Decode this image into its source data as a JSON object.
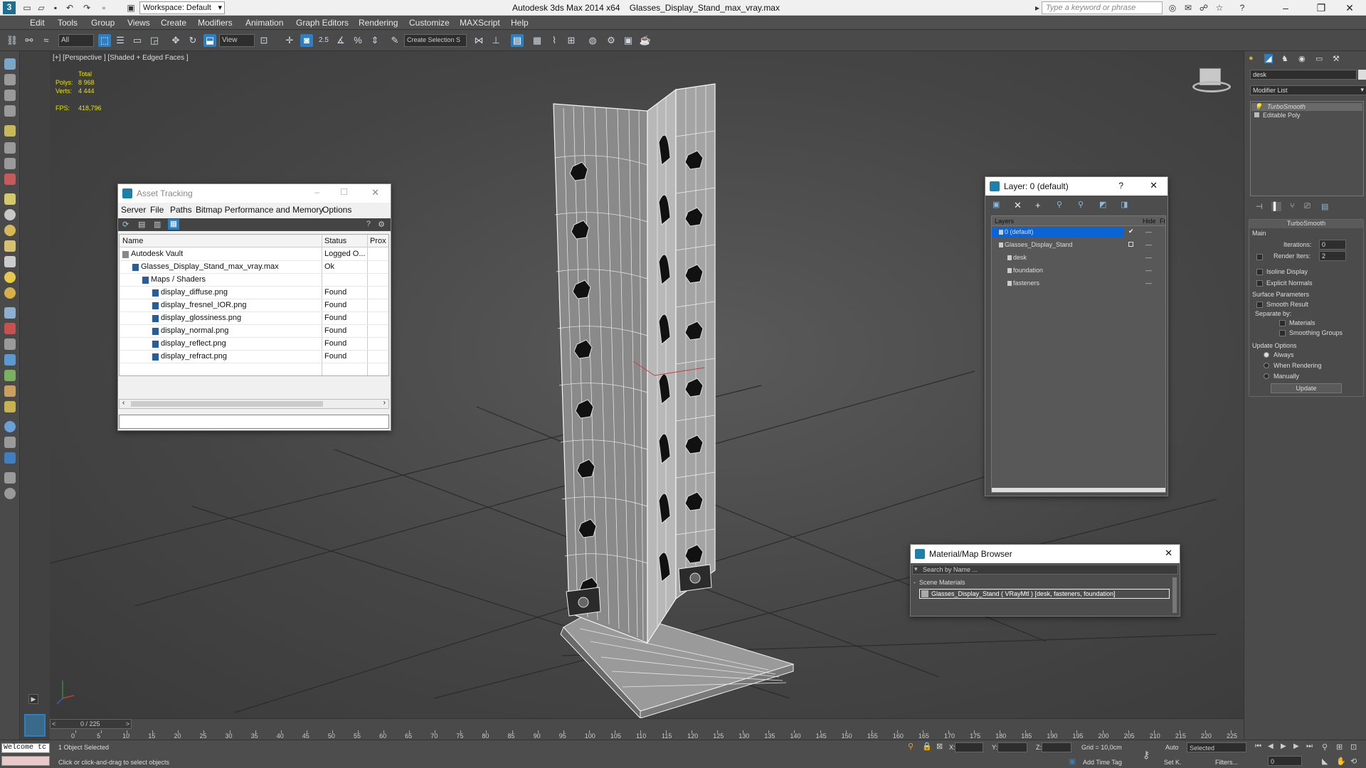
{
  "titlebar": {
    "app_title": "Autodesk 3ds Max  2014 x64",
    "file_title": "Glasses_Display_Stand_max_vray.max",
    "workspace": "Workspace: Default",
    "search_placeholder": "Type a keyword or phrase"
  },
  "menu": [
    "Edit",
    "Tools",
    "Group",
    "Views",
    "Create",
    "Modifiers",
    "Animation",
    "Graph Editors",
    "Rendering",
    "Customize",
    "MAXScript",
    "Help"
  ],
  "toolbar": {
    "selection_filter": "All",
    "ref_coord": "View",
    "snap_label": "2.5",
    "named_selection": "Create Selection S"
  },
  "viewport": {
    "label": "[+] [Perspective ] [Shaded + Edged Faces ]",
    "stats_total": "Total",
    "polys_label": "Polys:",
    "polys_value": "8 968",
    "verts_label": "Verts:",
    "verts_value": "4 444",
    "fps_label": "FPS:",
    "fps_value": "418,796"
  },
  "asset_tracking": {
    "title": "Asset Tracking",
    "menu": [
      "Server",
      "File",
      "Paths",
      "Bitmap Performance and Memory",
      "Options"
    ],
    "columns": [
      "Name",
      "Status",
      "Prox"
    ],
    "rows": [
      {
        "name": "Autodesk Vault",
        "status": "Logged O..."
      },
      {
        "name": "Glasses_Display_Stand_max_vray.max",
        "status": "Ok"
      },
      {
        "name": "Maps / Shaders",
        "status": ""
      },
      {
        "name": "display_diffuse.png",
        "status": "Found"
      },
      {
        "name": "display_fresnel_IOR.png",
        "status": "Found"
      },
      {
        "name": "display_glossiness.png",
        "status": "Found"
      },
      {
        "name": "display_normal.png",
        "status": "Found"
      },
      {
        "name": "display_reflect.png",
        "status": "Found"
      },
      {
        "name": "display_refract.png",
        "status": "Found"
      }
    ]
  },
  "layer_dialog": {
    "title": "Layer: 0 (default)",
    "help": "?",
    "columns": [
      "Layers",
      "Hide",
      "Fr"
    ],
    "rows": [
      {
        "name": "0 (default)"
      },
      {
        "name": "Glasses_Display_Stand"
      },
      {
        "name": "desk"
      },
      {
        "name": "foundation"
      },
      {
        "name": "fasteners"
      }
    ]
  },
  "material_browser": {
    "title": "Material/Map Browser",
    "search_placeholder": "Search by Name ...",
    "section": "Scene Materials",
    "item": "Glasses_Display_Stand ( VRayMtl ) [desk, fasteners, foundation]"
  },
  "command_panel": {
    "object_name": "desk",
    "modifier_list": "Modifier List",
    "stack": [
      "TurboSmooth",
      "Editable Poly"
    ],
    "rollout_title": "TurboSmooth",
    "main_label": "Main",
    "iterations_label": "Iterations:",
    "iterations_value": "0",
    "render_iters_label": "Render Iters:",
    "render_iters_value": "2",
    "isoline_label": "Isoline Display",
    "explicit_normals_label": "Explicit Normals",
    "surface_params_label": "Surface Parameters",
    "smooth_result_label": "Smooth Result",
    "separate_by_label": "Separate by:",
    "materials_label": "Materials",
    "smoothing_groups_label": "Smoothing Groups",
    "update_options_label": "Update Options",
    "always_label": "Always",
    "when_rendering_label": "When Rendering",
    "manually_label": "Manually",
    "update_button": "Update"
  },
  "timeline": {
    "frame_counter": "0 / 225",
    "ticks": [
      "0",
      "5",
      "10",
      "15",
      "20",
      "25",
      "30",
      "35",
      "40",
      "45",
      "50",
      "55",
      "60",
      "65",
      "70",
      "75",
      "80",
      "85",
      "90",
      "95",
      "100",
      "105",
      "110",
      "115",
      "120",
      "125",
      "130",
      "135",
      "140",
      "145",
      "150",
      "155",
      "160",
      "165",
      "170",
      "175",
      "180",
      "185",
      "190",
      "195",
      "200",
      "205",
      "210",
      "215",
      "220",
      "225"
    ]
  },
  "status": {
    "maxscript": "Welcome tc",
    "selected": "1 Object Selected",
    "prompt": "Click or click-and-drag to select objects",
    "x_label": "X:",
    "y_label": "Y:",
    "z_label": "Z:",
    "grid": "Grid = 10,0cm",
    "add_time_tag": "Add Time Tag",
    "auto_label": "Auto",
    "set_key_label": "Set K.",
    "selected_dropdown": "Selected",
    "filters_label": "Filters...",
    "frame_value": "0"
  },
  "colors": {
    "accent": "#1e7fa8",
    "selection_blue": "#0a64d6",
    "stat_yellow": "#e8e000"
  }
}
